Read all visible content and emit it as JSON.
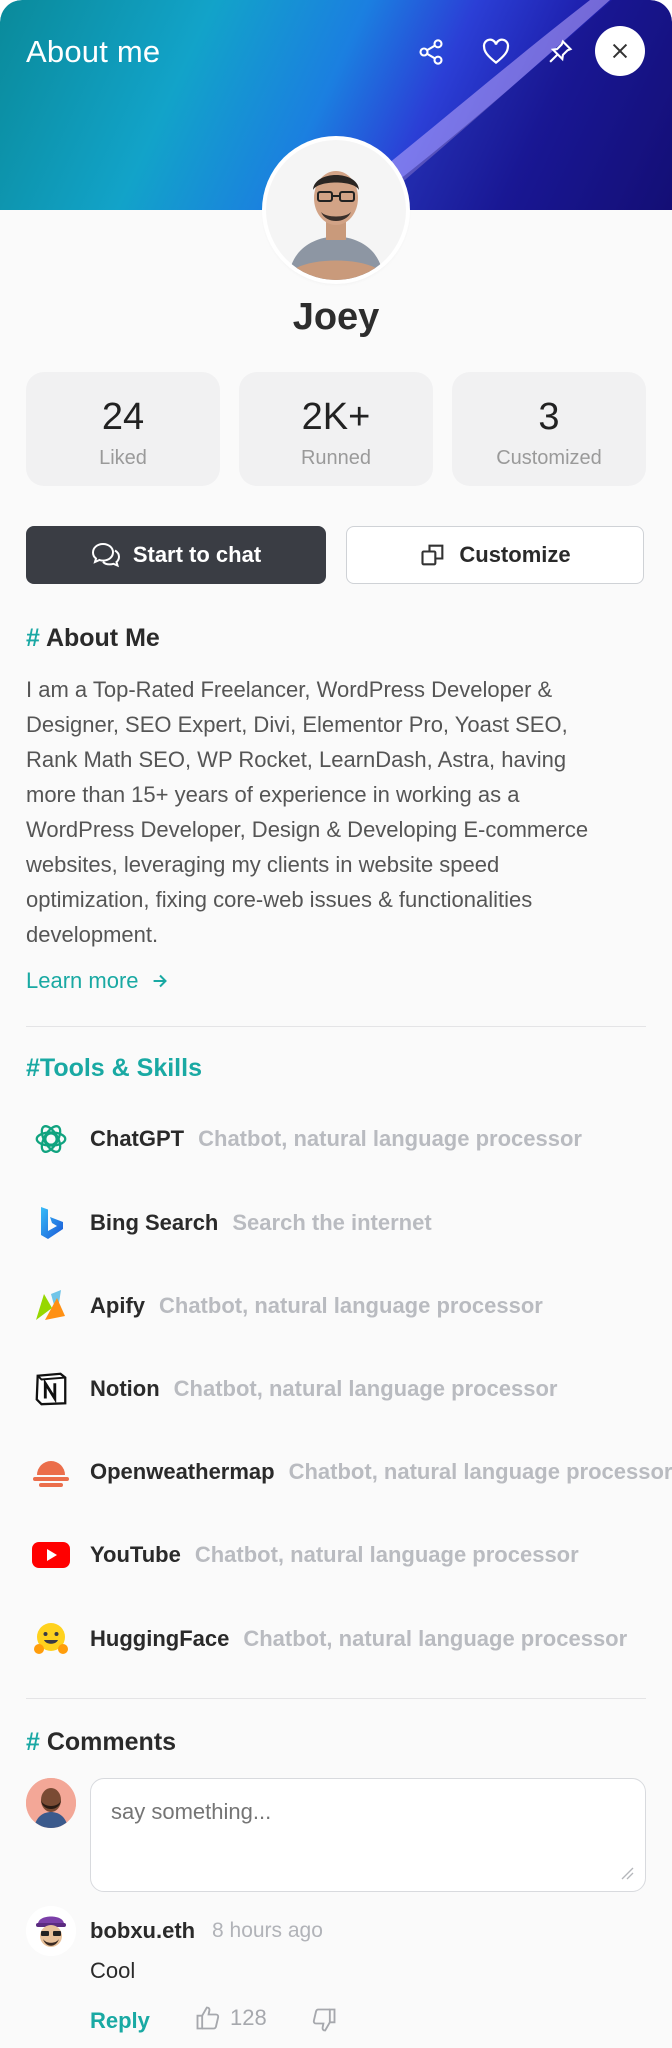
{
  "header": {
    "title": "About me",
    "actions": [
      "share-icon",
      "heart-icon",
      "pin-icon",
      "close-icon"
    ],
    "accent": "#1aa8a4"
  },
  "profile": {
    "name": "Joey",
    "stats": [
      {
        "value": "24",
        "label": "Liked"
      },
      {
        "value": "2K+",
        "label": "Runned"
      },
      {
        "value": "3",
        "label": "Customized"
      }
    ],
    "buttons": {
      "chat": "Start to chat",
      "customize": "Customize"
    }
  },
  "about": {
    "hash": "#",
    "title": "About Me",
    "lines": [
      "I am a Top-Rated Freelancer, WordPress Developer &",
      "Designer, SEO Expert, Divi, Elementor Pro, Yoast SEO,",
      "Rank Math SEO, WP Rocket, LearnDash, Astra, having",
      "more than 15+ years of experience in working as a",
      "WordPress Developer, Design & Developing E-commerce",
      "websites, leveraging my clients in website speed",
      "optimization, fixing core-web issues & functionalities",
      "development."
    ],
    "learn_more": "Learn more"
  },
  "tools": {
    "title": "#Tools & Skills",
    "items": [
      {
        "name": "ChatGPT",
        "desc": "Chatbot, natural language processor",
        "icon": "chatgpt-icon"
      },
      {
        "name": "Bing Search",
        "desc": "Search the internet",
        "icon": "bing-icon"
      },
      {
        "name": "Apify",
        "desc": "Chatbot, natural language processor",
        "icon": "apify-icon"
      },
      {
        "name": "Notion",
        "desc": "Chatbot, natural language processor",
        "icon": "notion-icon"
      },
      {
        "name": "Openweathermap",
        "desc": "Chatbot, natural language processor",
        "icon": "openweathermap-icon"
      },
      {
        "name": "YouTube",
        "desc": "Chatbot, natural language processor",
        "icon": "youtube-icon"
      },
      {
        "name": "HuggingFace",
        "desc": "Chatbot, natural language processor",
        "icon": "huggingface-icon"
      }
    ]
  },
  "comments": {
    "hash": "#",
    "title": "Comments",
    "placeholder": "say something...",
    "items": [
      {
        "user": "bobxu.eth",
        "time": "8 hours ago",
        "text": "Cool",
        "reply": "Reply",
        "likes": "128"
      }
    ]
  }
}
